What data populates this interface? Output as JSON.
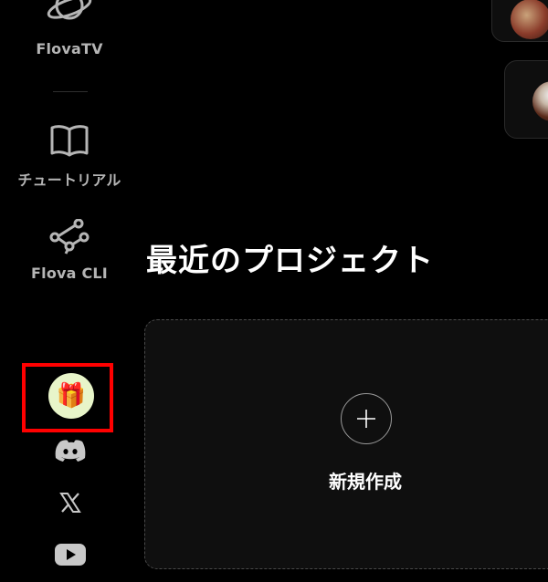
{
  "sidebar": {
    "items": [
      {
        "label": "FlovaTV",
        "icon": "planet-icon"
      },
      {
        "label": "チュートリアル",
        "icon": "book-icon"
      },
      {
        "label": "Flova CLI",
        "icon": "share-nodes-icon"
      }
    ],
    "gift": {
      "icon": "gift-icon",
      "glyph": "🎁"
    },
    "social": [
      {
        "icon": "discord-icon"
      },
      {
        "icon": "x-icon"
      },
      {
        "icon": "youtube-icon"
      }
    ]
  },
  "main": {
    "section_title": "最近のプロジェクト",
    "new_project_label": "新規作成"
  },
  "colors": {
    "background": "#000000",
    "highlight_frame": "#ff0000",
    "gift_bg": "#e8f5c9",
    "muted_text": "#b5b5b5"
  }
}
